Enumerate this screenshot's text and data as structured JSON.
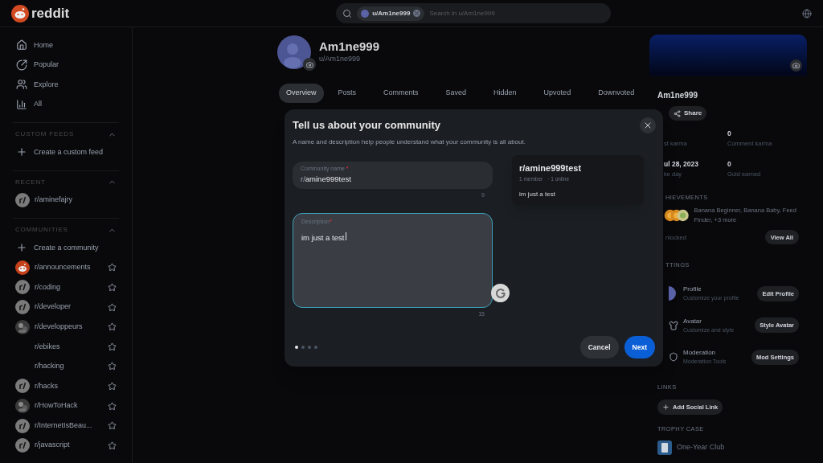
{
  "header": {
    "logo": "reddit",
    "search": {
      "chip": "u/Am1ne999",
      "placeholder": "Search in u/Am1ne999"
    }
  },
  "sidebar": {
    "nav": [
      {
        "label": "Home"
      },
      {
        "label": "Popular"
      },
      {
        "label": "Explore"
      },
      {
        "label": "All"
      }
    ],
    "sections": [
      {
        "title": "CUSTOM FEEDS",
        "expanded": true,
        "items": [
          {
            "kind": "create",
            "label": "Create a custom feed"
          }
        ]
      },
      {
        "title": "RECENT",
        "expanded": true,
        "items": [
          {
            "kind": "community",
            "label": "r/aminefajry"
          }
        ]
      },
      {
        "title": "COMMUNITIES",
        "expanded": true,
        "items": [
          {
            "kind": "create",
            "label": "Create a community"
          },
          {
            "kind": "official",
            "label": "r/announcements",
            "favorited": false
          },
          {
            "kind": "community",
            "label": "r/coding",
            "favorited": false
          },
          {
            "kind": "community",
            "label": "r/developer",
            "favorited": false
          },
          {
            "label": "r/developpeurs",
            "favorited": false
          },
          {
            "kind": "blank",
            "label": "r/ebikes",
            "favorited": false
          },
          {
            "kind": "blank",
            "label": "r/hacking",
            "favorited": false
          },
          {
            "kind": "community",
            "label": "r/hacks",
            "favorited": false
          },
          {
            "label": "r/HowToHack",
            "favorited": false
          },
          {
            "kind": "community",
            "label": "r/InternetIsBeau...",
            "favorited": false
          },
          {
            "kind": "community",
            "label": "r/javascript",
            "favorited": false
          }
        ]
      }
    ]
  },
  "profile": {
    "name": "Am1ne999",
    "username": "u/Am1ne999",
    "tabs": [
      {
        "label": "Overview",
        "selected": true
      },
      {
        "label": "Posts",
        "selected": false
      },
      {
        "label": "Comments",
        "selected": false
      },
      {
        "label": "Saved",
        "selected": false
      },
      {
        "label": "Hidden",
        "selected": false
      },
      {
        "label": "Upvoted",
        "selected": false
      },
      {
        "label": "Downvoted",
        "selected": false
      }
    ]
  },
  "modal": {
    "title": "Tell us about your community",
    "subtitle": "A name and description help people understand what your community is all about.",
    "name_field": {
      "label": "Community name",
      "required_mark": "*",
      "prefix": "r/",
      "value": "amine999test",
      "counter": "9",
      "focused": false
    },
    "description_field": {
      "label": "Description",
      "required_mark": "*",
      "value": "im just a test",
      "counter": "15",
      "focused": true
    },
    "preview": {
      "name": "r/amine999test",
      "members": "1 member",
      "online": "· 1 online",
      "description": "im just a test"
    },
    "steps": [
      {
        "selected": true
      },
      {
        "selected": false
      },
      {
        "selected": false
      },
      {
        "selected": false
      }
    ],
    "cancel": "Cancel",
    "next": "Next"
  },
  "right_panel": {
    "name": "Am1ne999",
    "share": "Share",
    "stats": [
      {
        "label": "st karma"
      },
      {
        "value": "ul 28, 2023",
        "label": "ke day"
      },
      {
        "value": "0",
        "label": "Comment karma"
      },
      {
        "value": "0",
        "label": "Gold earned"
      }
    ],
    "achievements": {
      "heading": "HIEVEMENTS",
      "text": "Banana Beginner, Banana Baby, Feed Finder, +3 more",
      "unlocked": "nlocked",
      "button": "View All"
    },
    "settings": {
      "heading": "TTINGS",
      "items": [
        {
          "title": "Profile",
          "subtitle": "Customize your profile",
          "button": "Edit Profile"
        },
        {
          "title": "Avatar",
          "subtitle": "Customize and style",
          "button": "Style Avatar"
        },
        {
          "title": "Moderation",
          "subtitle": "Moderation Tools",
          "button": "Mod Settings"
        }
      ]
    },
    "links": {
      "heading": "LINKS",
      "button": "Add Social Link"
    },
    "trophies": {
      "heading": "TROPHY CASE",
      "items": [
        {
          "name": "One-Year Club"
        }
      ]
    }
  }
}
